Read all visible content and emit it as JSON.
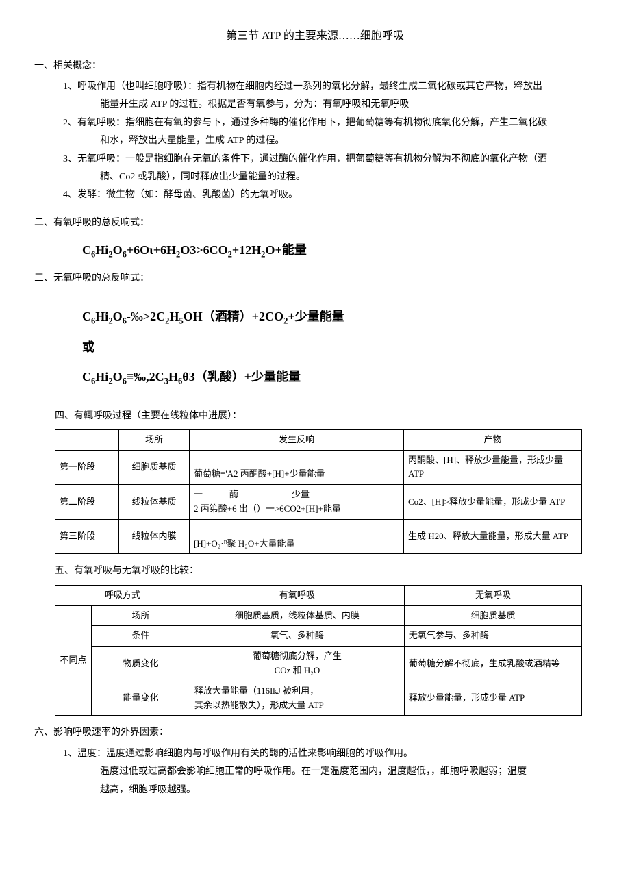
{
  "title": "第三节 ATP 的主要来源……细胞呼吸",
  "sec1": {
    "heading": "一、相关概念：",
    "p1a": "1、呼吸作用（也叫细胞呼吸）：指有机物在细胞内经过一系列的氧化分解，最终生成二氧化碳或其它产物，释放出",
    "p1b": "能量并生成 ATP 的过程。根据是否有氧参与，分为：有氧呼吸和无氧呼吸",
    "p2a": "2、有氧呼吸：指细胞在有氧的参与下，通过多种酶的催化作用下，把葡萄糖等有机物彻底氧化分解，产生二氧化碳",
    "p2b": "和水，释放出大量能量，生成 ATP 的过程。",
    "p3a": "3、无氧呼吸：一般是指细胞在无氧的条件下，通过酶的催化作用，把葡萄糖等有机物分解为不彻底的氧化产物（酒",
    "p3b": "精、Co2 或乳酸），同时释放出少量能量的过程。",
    "p4": "4、发酵：微生物（如：酵母菌、乳酸菌）的无氧呼吸。"
  },
  "sec2": {
    "heading": "二、有氧呼吸的总反响式：",
    "eq_head": "C",
    "eq_tail": "能量"
  },
  "sec3": {
    "heading": "三、无氧呼吸的总反响式：",
    "eq1_mid": "（酒精）",
    "eq1_tail": "少量能量",
    "or": "或",
    "eq2_mid": "（乳酸）",
    "eq2_tail": "少量能量"
  },
  "sec4": {
    "heading": "四、有輒呼吸过程（主要在线粒体中进展）：",
    "table": {
      "h1": "",
      "h2": "场所",
      "h3": "发生反响",
      "h4": "产物",
      "r1c1": "第一阶段",
      "r1c2": "细胞质基质",
      "r1c3": "葡萄糖≡'A2 丙酮酸+[H]+少量能量",
      "r1c4": "丙酮酸、[H]、释放少量能量，形成少量 ATP",
      "r2c1": "第二阶段",
      "r2c2": "线粒体基质",
      "r2c3a": "一　　　酶　　　　　　少量",
      "r2c3b": "2 丙笫酸+6 出（）一>6CO2+[H]+能量",
      "r2c4": "Co2、[H]>释放少量能量，形成少量 ATP",
      "r3c1": "第三阶段",
      "r3c2": "线粒体内膜",
      "r3c3": "[H]+O₂·ᴮ聚 H₂O+大量能量",
      "r3c4": "生成 H20、释放大量能量，形成大量 ATP"
    }
  },
  "sec5": {
    "heading": "五、有氧呼吸与无氧呼吸的比较：",
    "table": {
      "h1": "呼吸方式",
      "h2": "有氧呼吸",
      "h3": "无氧呼吸",
      "rowgroup": "不同点",
      "r1c1": "场所",
      "r1c2": "细胞质基质，线粒体基质、内膜",
      "r1c3": "细胞质基质",
      "r2c1": "条件",
      "r2c2": "氧气、多种酶",
      "r2c3": "无氧气参与、多种酶",
      "r3c1": "物质变化",
      "r3c2a": "葡萄糖彻底分解，产生",
      "r3c2b": "COz 和 H₂O",
      "r3c3": "葡萄糖分解不彻底，生成乳酸或酒精等",
      "r4c1": "能量变化",
      "r4c2a": "释放大量能量（116IkJ 被利用，",
      "r4c2b": "其余以热能散失），形成大量 ATP",
      "r4c3": "释放少量能量，形成少量 ATP"
    }
  },
  "sec6": {
    "heading": "六、影响呼吸速率的外界因素：",
    "p1a": "1、温度：温度通过影响细胞内与呼吸作用有关的酶的活性来影响细胞的呼吸作用。",
    "p1b": "温度过低或过高都会影响细胞正常的呼吸作用。在一定温度范围内，温度越低，，细胞呼吸越弱；温度",
    "p1c": "越高，细胞呼吸越强。"
  }
}
